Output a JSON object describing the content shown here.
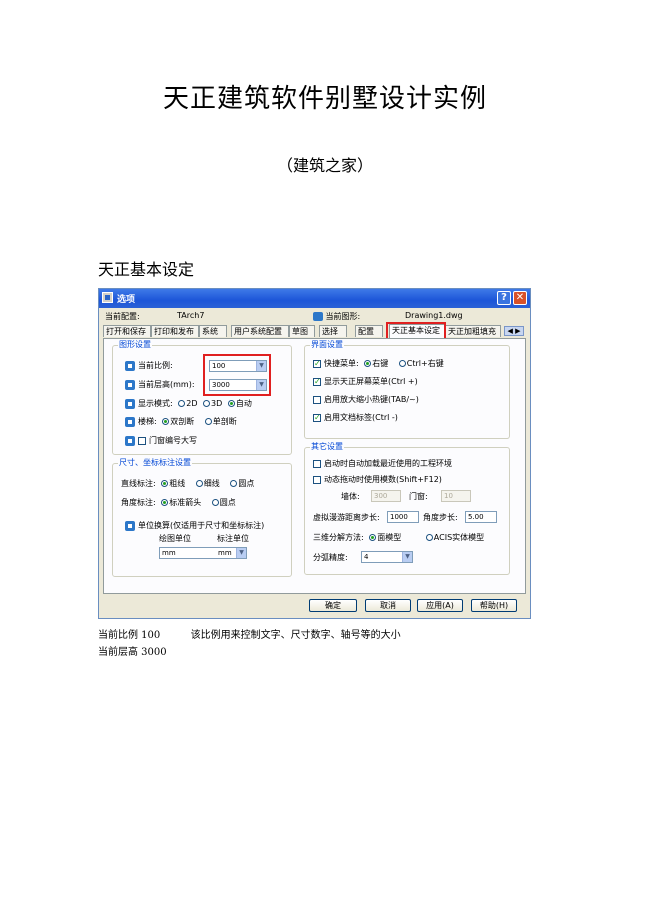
{
  "document": {
    "title": "天正建筑软件别墅设计实例",
    "subtitle": "（建筑之家）",
    "section_heading": "天正基本设定",
    "captions": [
      {
        "label": "当前比例 100",
        "text": "该比例用来控制文字、尺寸数字、轴号等的大小"
      },
      {
        "label": "当前层高 3000",
        "text": ""
      }
    ]
  },
  "dialog": {
    "title": "选项",
    "current_config_label": "当前配置:",
    "current_config_value": "TArch7",
    "current_drawing_label": "当前图形:",
    "current_drawing_value": "Drawing1.dwg",
    "tabs": [
      "打开和保存",
      "打印和发布",
      "系统",
      "用户系统配置",
      "草图",
      "选择",
      "配置",
      "天正基本设定",
      "天正加粗填充"
    ],
    "active_tab": "天正基本设定",
    "graphics_settings": {
      "legend": "图形设置",
      "scale_label": "当前比例:",
      "scale_value": "100",
      "floor_height_label": "当前层高(mm):",
      "floor_height_value": "3000",
      "display_mode_label": "显示模式:",
      "display_options": [
        "2D",
        "3D",
        "自动"
      ],
      "display_selected": "自动",
      "stairs_label": "楼梯:",
      "stairs_options": [
        "双剖断",
        "单剖断"
      ],
      "stairs_selected": "双剖断",
      "door_window_label": "门窗编号大写",
      "door_window_checked": false
    },
    "dimension_settings": {
      "legend": "尺寸、坐标标注设置",
      "linear_label": "直线标注:",
      "linear_options": [
        "粗线",
        "细线",
        "圆点"
      ],
      "linear_selected": "粗线",
      "angle_label": "角度标注:",
      "angle_options": [
        "标准箭头",
        "圆点"
      ],
      "angle_selected": "标准箭头",
      "unit_conversion_label": "单位换算(仅适用于尺寸和坐标标注)",
      "drawing_unit_label": "绘图单位",
      "annotation_unit_label": "标注单位",
      "drawing_unit_value": "mm",
      "annotation_unit_value": "mm"
    },
    "interface_settings": {
      "legend": "界面设置",
      "shortcut_menu_label": "快捷菜单:",
      "shortcut_options": [
        "右键",
        "Ctrl+右键"
      ],
      "shortcut_selected": "右键",
      "checkboxes": [
        {
          "label": "显示天正屏幕菜单(Ctrl +)",
          "checked": true
        },
        {
          "label": "启用放大缩小热键(TAB/~)",
          "checked": false
        },
        {
          "label": "启用文档标签(Ctrl -)",
          "checked": true
        }
      ]
    },
    "other_settings": {
      "legend": "其它设置",
      "checkboxes": [
        {
          "label": "启动时自动加载最近使用的工程环境",
          "checked": false
        },
        {
          "label": "动态拖动时使用模数(Shift+F12)",
          "checked": false
        }
      ],
      "wall_label": "墙体:",
      "wall_value": "300",
      "window_label": "门窗:",
      "window_value": "10",
      "virtual_loft_label": "虚拟漫游距离步长:",
      "virtual_loft_value": "1000",
      "angle_step_label": "角度步长:",
      "angle_step_value": "5.00",
      "decompose_label": "三维分解方法:",
      "decompose_options": [
        "面模型",
        "ACIS实体模型"
      ],
      "decompose_selected": "面模型",
      "arc_precision_label": "分弧精度:",
      "arc_precision_value": "4"
    },
    "buttons": {
      "ok": "确定",
      "cancel": "取消",
      "apply": "应用(A)",
      "help": "帮助(H)"
    }
  }
}
